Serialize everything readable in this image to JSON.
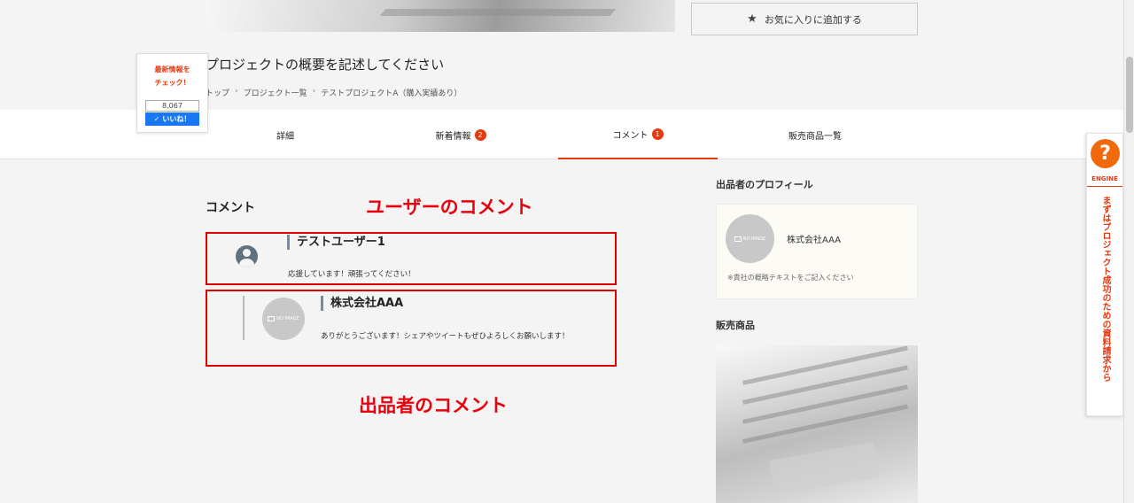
{
  "favorite_button": {
    "label": "お気に入りに追加する",
    "icon": "star-icon"
  },
  "page_title": "プロジェクトの概要を記述してください",
  "breadcrumb": [
    "トップ",
    "プロジェクト一覧",
    "テストプロジェクトA（購入実績あり）"
  ],
  "like_widget": {
    "text_line1": "最新情報を",
    "text_line2": "チェック！",
    "count": "8,067",
    "button_label": "いいね！"
  },
  "tabs": [
    {
      "label": "詳細",
      "badge": ""
    },
    {
      "label": "新着情報",
      "badge": "2"
    },
    {
      "label": "コメント",
      "badge": "1",
      "active": true
    },
    {
      "label": "販売商品一覧",
      "badge": ""
    }
  ],
  "comments_section": {
    "title": "コメント",
    "user_label": "ユーザーのコメント",
    "seller_label": "出品者のコメント",
    "user_comment": {
      "name": "テストユーザー1",
      "text": "応援しています！頑張ってください！"
    },
    "seller_comment": {
      "name": "株式会社AAA",
      "text": "ありがとうございます！シェアやツイートもぜひよろしくお願いします！"
    }
  },
  "no_image_text": "NO IMAGE",
  "sidebar": {
    "profile_heading": "出品者のプロフィール",
    "profile_name": "株式会社AAA",
    "profile_desc": "※貴社の概略テキストをご記入ください",
    "products_heading": "販売商品"
  },
  "engine_widget": {
    "brand": "ENGINE",
    "text": "まずはプロジェクト成功のための資料請求から"
  },
  "colors": {
    "accent": "#e8380d",
    "annotation": "#e00000"
  }
}
